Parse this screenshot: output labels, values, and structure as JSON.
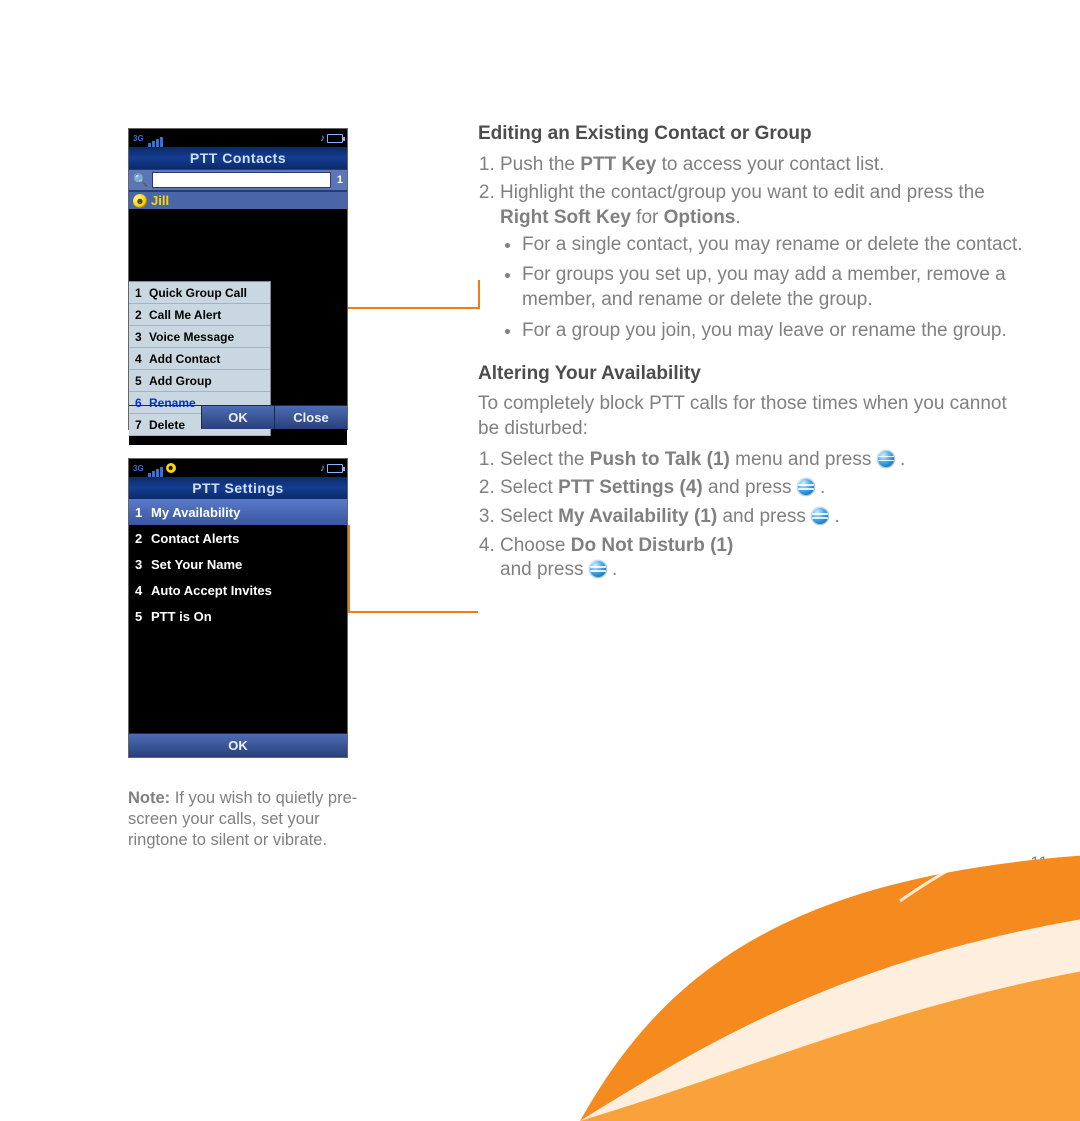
{
  "phone1": {
    "title": "PTT Contacts",
    "search_count": "1",
    "contact_name": "Jill",
    "menu": [
      {
        "n": "1",
        "label": "Quick Group Call"
      },
      {
        "n": "2",
        "label": "Call Me Alert"
      },
      {
        "n": "3",
        "label": "Voice Message"
      },
      {
        "n": "4",
        "label": "Add Contact"
      },
      {
        "n": "5",
        "label": "Add Group"
      },
      {
        "n": "6",
        "label": "Rename"
      },
      {
        "n": "7",
        "label": "Delete"
      }
    ],
    "softkey_center": "OK",
    "softkey_right": "Close"
  },
  "phone2": {
    "title": "PTT Settings",
    "rows": [
      {
        "n": "1",
        "label": "My Availability"
      },
      {
        "n": "2",
        "label": "Contact Alerts"
      },
      {
        "n": "3",
        "label": "Set Your Name"
      },
      {
        "n": "4",
        "label": "Auto Accept Invites"
      },
      {
        "n": "5",
        "label": "PTT is On"
      }
    ],
    "softkey_center": "OK"
  },
  "text": {
    "h1": "Editing an Existing Contact or Group",
    "step1a": "Push the ",
    "step1b": "PTT Key",
    "step1c": " to access your contact list.",
    "step2a": "Highlight the contact/group you want to edit and press the ",
    "step2b": "Right Soft Key",
    "step2c": " for ",
    "step2d": "Options",
    "step2e": ".",
    "b1": "For a single contact, you may rename or delete the contact.",
    "b2": "For groups you set up, you may add a member, remove a member, and rename or delete the group.",
    "b3": "For a group you join, you may leave or rename the group.",
    "h2": "Altering Your Availability",
    "intro": "To completely block PTT calls for those times when you cannot be disturbed:",
    "s1a": "Select the ",
    "s1b": "Push to Talk (1)",
    "s1c": " menu and press ",
    "s2a": "Select ",
    "s2b": "PTT Settings (4)",
    "s2c": " and press ",
    "s3a": "Select ",
    "s3b": "My Availability (1)",
    "s3c": " and press ",
    "s4a": "Choose ",
    "s4b": "Do Not Disturb (1)",
    "s4c": " and press ",
    "dot": "."
  },
  "note": {
    "label": "Note:",
    "text": " If you wish to quietly pre-screen your calls, set your ringtone to silent or vibrate."
  },
  "page_number": "11"
}
